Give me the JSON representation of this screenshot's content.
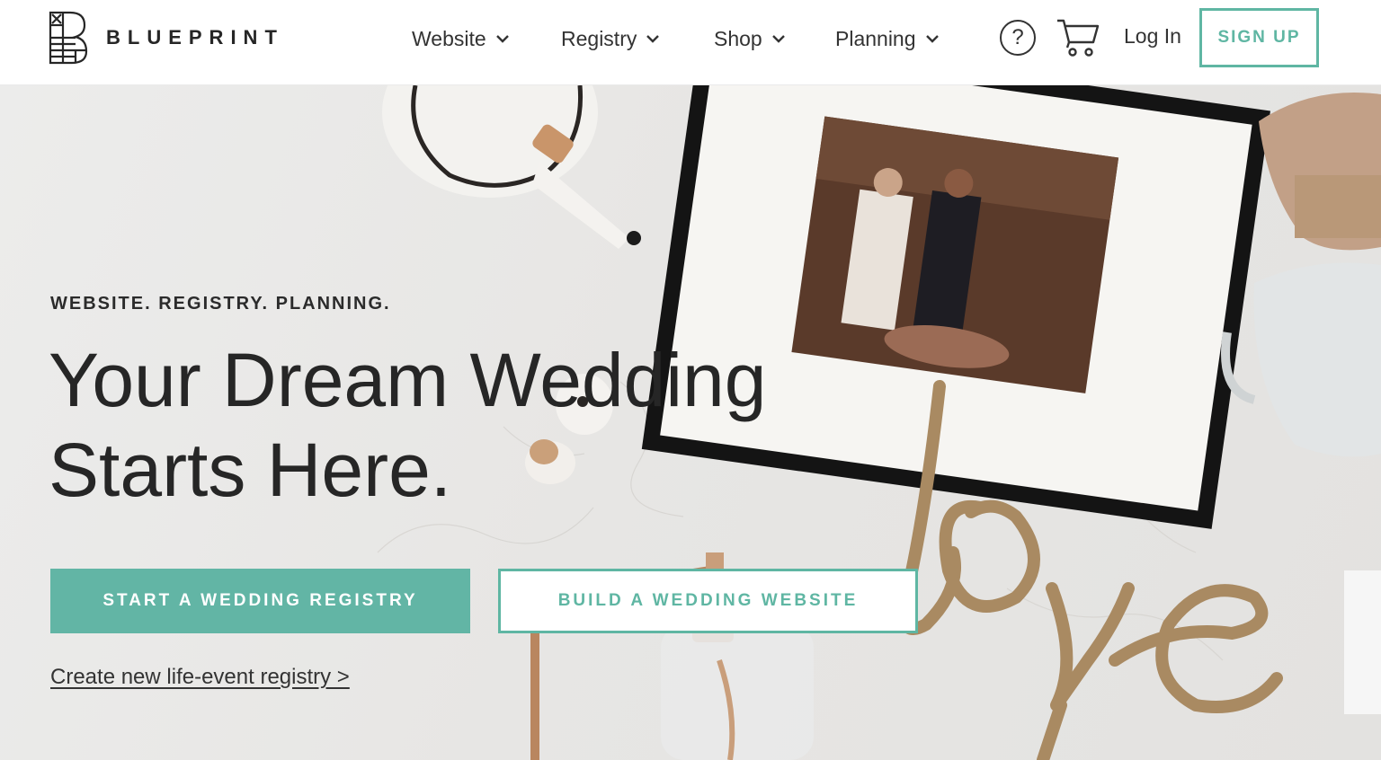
{
  "brand": {
    "name": "BLUEPRINT"
  },
  "nav": {
    "items": [
      {
        "label": "Website"
      },
      {
        "label": "Registry"
      },
      {
        "label": "Shop"
      },
      {
        "label": "Planning"
      }
    ],
    "help_symbol": "?",
    "login_label": "Log In",
    "signup_label": "SIGN UP"
  },
  "hero": {
    "tagline": "WEBSITE. REGISTRY. PLANNING.",
    "headline_line1": "Your Dream Wedding",
    "headline_line2": "Starts Here.",
    "primary_cta": "START A WEDDING REGISTRY",
    "secondary_cta": "BUILD A WEDDING WEBSITE",
    "life_event_link": "Create new life-event registry >"
  },
  "icons": {
    "help": "help-circle-icon",
    "cart": "shopping-cart-icon",
    "caret": "chevron-down-icon"
  },
  "colors": {
    "accent": "#5fb6a3",
    "accent_fill": "#62b5a5",
    "text": "#262626"
  }
}
